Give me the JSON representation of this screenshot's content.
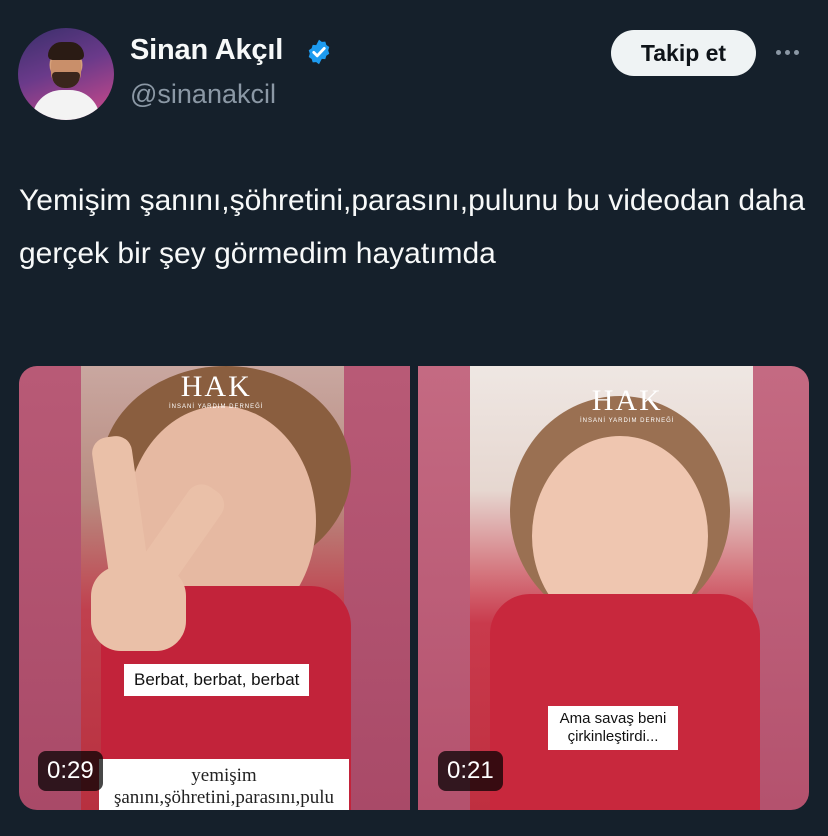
{
  "author": {
    "name": "Sinan Akçıl",
    "handle": "@sinanakcil",
    "verified_color": "#1d9bf0"
  },
  "actions": {
    "follow_label": "Takip et",
    "more_icon": "more-horizontal-icon"
  },
  "tweet": {
    "text": "Yemişim şanını,şöhretini,parasını,pulunu bu videodan daha gerçek bir şey görmedim hayatımda"
  },
  "media": [
    {
      "watermark": "HAK",
      "watermark_sub": "İNSANİ YARDIM DERNEĞİ",
      "subtitle": "Berbat, berbat, berbat",
      "caption": "yemişim şanını,şöhretini,parasını,pulu",
      "duration": "0:29"
    },
    {
      "watermark": "HAK",
      "watermark_sub": "İNSANİ YARDIM DERNEĞİ",
      "subtitle": "Ama savaş beni çirkinleştirdi...",
      "duration": "0:21"
    }
  ]
}
